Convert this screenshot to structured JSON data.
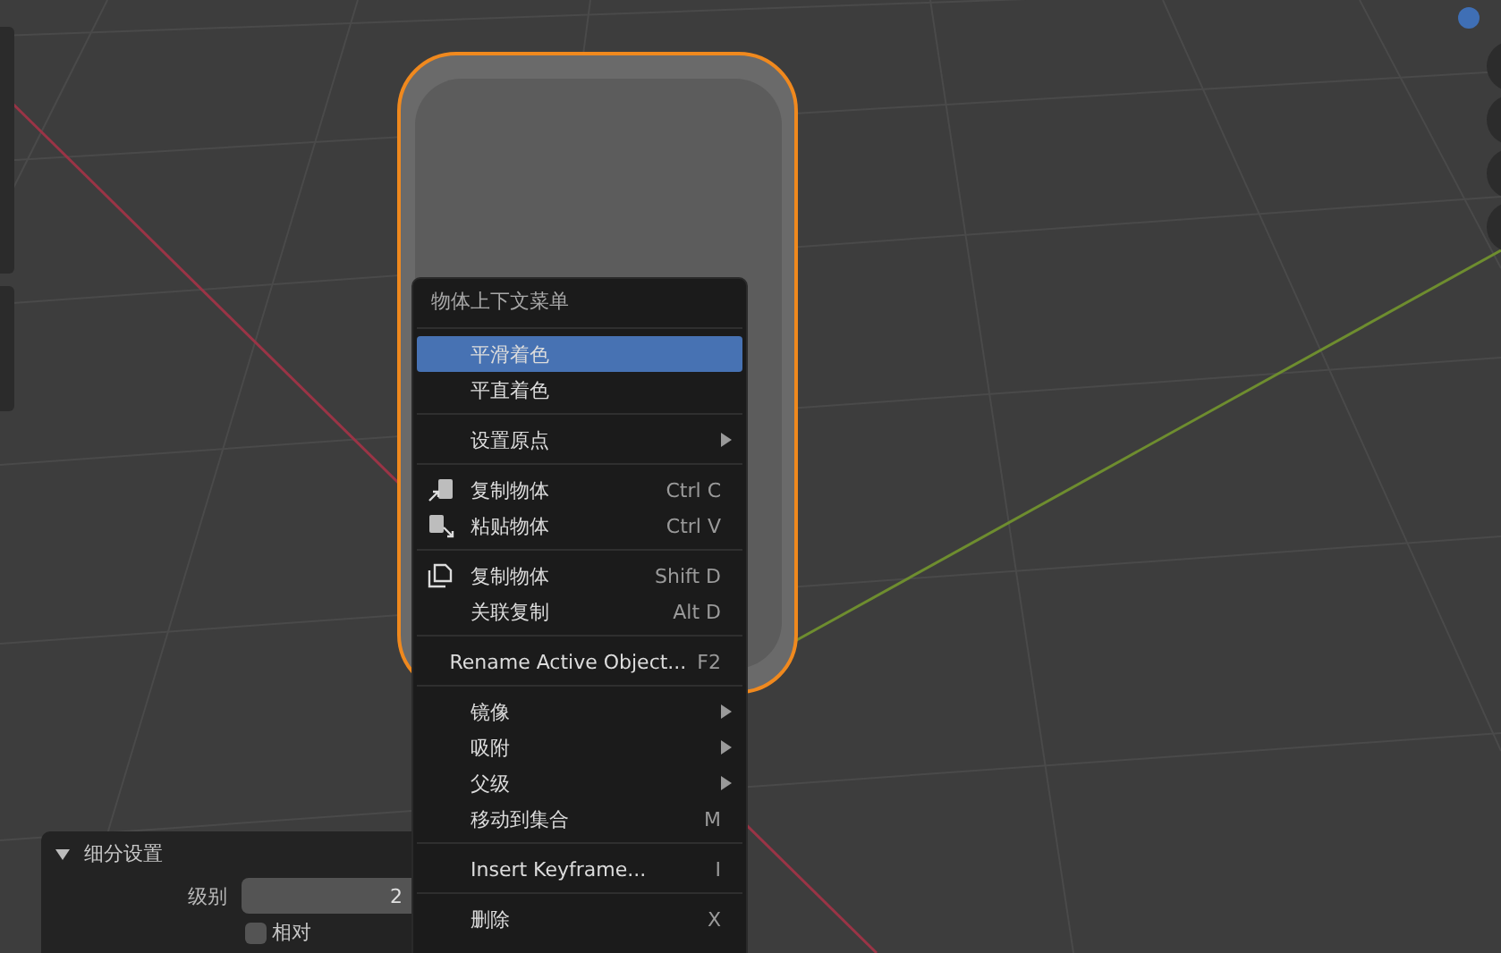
{
  "context_menu": {
    "title": "物体上下文菜单",
    "items": [
      {
        "kind": "separator"
      },
      {
        "kind": "plain",
        "label": "平滑着色",
        "selected": true,
        "submenu": false
      },
      {
        "kind": "plain",
        "label": "平直着色",
        "selected": false,
        "submenu": false
      },
      {
        "kind": "separator"
      },
      {
        "kind": "plain",
        "label": "设置原点",
        "selected": false,
        "submenu": true
      },
      {
        "kind": "separator"
      },
      {
        "kind": "copy",
        "label": "复制物体",
        "shortcut": "Ctrl C",
        "selected": false,
        "submenu": false
      },
      {
        "kind": "paste",
        "label": "粘贴物体",
        "shortcut": "Ctrl V",
        "selected": false,
        "submenu": false
      },
      {
        "kind": "separator"
      },
      {
        "kind": "duplicate",
        "label": "复制物体",
        "shortcut": "Shift D",
        "selected": false,
        "submenu": false
      },
      {
        "kind": "plain",
        "label": "关联复制",
        "shortcut": "Alt D",
        "selected": false,
        "submenu": false
      },
      {
        "kind": "separator"
      },
      {
        "kind": "plain",
        "label": "Rename Active Object...",
        "shortcut": "F2",
        "selected": false,
        "submenu": false
      },
      {
        "kind": "separator"
      },
      {
        "kind": "plain",
        "label": "镜像",
        "selected": false,
        "submenu": true
      },
      {
        "kind": "plain",
        "label": "吸附",
        "selected": false,
        "submenu": true
      },
      {
        "kind": "plain",
        "label": "父级",
        "selected": false,
        "submenu": true
      },
      {
        "kind": "plain",
        "label": "移动到集合",
        "shortcut": "M",
        "selected": false,
        "submenu": false
      },
      {
        "kind": "separator"
      },
      {
        "kind": "plain",
        "label": "Insert Keyframe...",
        "shortcut": "I",
        "selected": false,
        "submenu": false
      },
      {
        "kind": "separator"
      },
      {
        "kind": "plain",
        "label": "删除",
        "shortcut": "X",
        "selected": false,
        "submenu": false
      }
    ]
  },
  "operator_panel": {
    "title": "细分设置",
    "expanded": true,
    "fields": [
      {
        "label": "级别",
        "value": "2"
      }
    ],
    "checkbox": {
      "label": "相对",
      "checked": false
    }
  }
}
